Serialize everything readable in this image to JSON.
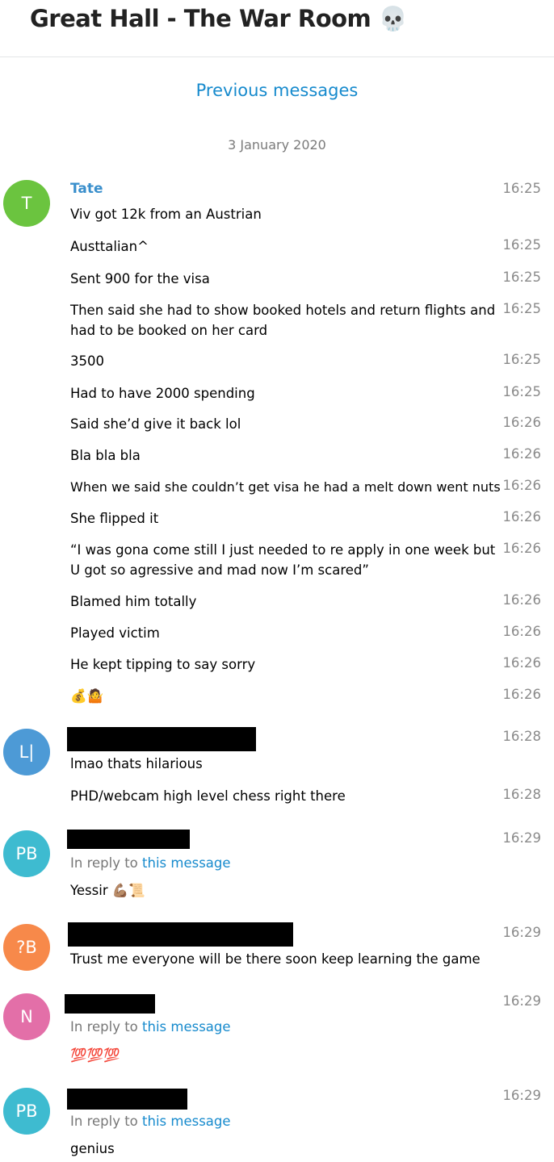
{
  "header": {
    "title": "Great Hall - The War Room 💀"
  },
  "history": {
    "previous_label": "Previous messages",
    "date": "3 January 2020"
  },
  "reply_prefix": "In reply to",
  "reply_link": "this message",
  "groups": [
    {
      "avatar": {
        "initials": "T",
        "color": "#6bc43f"
      },
      "sender": "Tate",
      "messages": [
        {
          "text": "Viv got 12k from an Austrian",
          "time": "16:25"
        },
        {
          "text": "Austtalian^",
          "time": "16:25"
        },
        {
          "text": "Sent 900 for the visa",
          "time": "16:25"
        },
        {
          "text": "Then said she had to show booked hotels and return flights and had to be booked on her card",
          "time": "16:25"
        },
        {
          "text": "3500",
          "time": "16:25"
        },
        {
          "text": "Had to have 2000 spending",
          "time": "16:25"
        },
        {
          "text": "Said she’d give it back lol",
          "time": "16:26"
        },
        {
          "text": "Bla bla bla",
          "time": "16:26"
        },
        {
          "text": "When we said she couldn’t get visa he had a melt down went nuts",
          "time": "16:26"
        },
        {
          "text": "She flipped it",
          "time": "16:26"
        },
        {
          "text": "“I was gona come still I just needed to re apply in one week but U got so agressive and mad now I’m scared”",
          "time": "16:26"
        },
        {
          "text": "Blamed him totally",
          "time": "16:26"
        },
        {
          "text": "Played victim",
          "time": "16:26"
        },
        {
          "text": "He kept tipping to say sorry",
          "time": "16:26"
        },
        {
          "text": "💰🤷",
          "time": "16:26"
        }
      ]
    },
    {
      "avatar": {
        "initials": "L|",
        "color": "#4d9ad6"
      },
      "messages": [
        {
          "text": "lmao thats hilarious",
          "time": "16:28"
        },
        {
          "text": "PHD/webcam high level chess right there",
          "time": "16:28"
        }
      ]
    },
    {
      "avatar": {
        "initials": "PB",
        "color": "#3ebbd0"
      },
      "messages": [
        {
          "text": "Yessir 💪🏽📜",
          "time": "16:29"
        }
      ]
    },
    {
      "avatar": {
        "initials": "?B",
        "color": "#f7894a"
      },
      "messages": [
        {
          "text": "Trust me everyone will be there soon keep learning the game",
          "time": "16:29"
        }
      ]
    },
    {
      "avatar": {
        "initials": "N",
        "color": "#e36fa8"
      },
      "messages": [
        {
          "text": "💯💯💯",
          "time": "16:29"
        }
      ]
    },
    {
      "avatar": {
        "initials": "PB",
        "color": "#3ebbd0"
      },
      "messages": [
        {
          "text": "genius",
          "time": "16:29"
        }
      ]
    }
  ]
}
